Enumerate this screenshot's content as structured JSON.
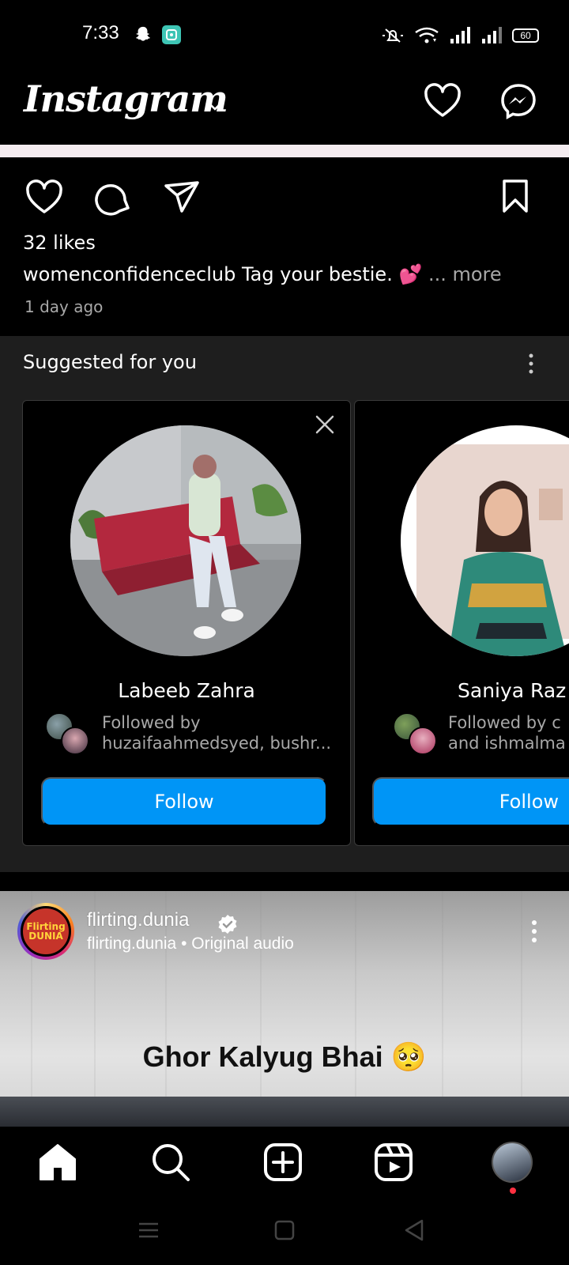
{
  "status_bar": {
    "time": "7:33",
    "battery": "60",
    "icons": [
      "snapchat-icon",
      "app-icon",
      "mute-icon",
      "wifi-icon",
      "signal-icon",
      "signal-icon-2",
      "battery-icon"
    ]
  },
  "header": {
    "logo": "Instagram",
    "icons": [
      "chevron-down-icon",
      "heart-icon",
      "messenger-icon"
    ]
  },
  "post": {
    "likes": "32 likes",
    "caption_user": "womenconfidenceclub",
    "caption_text": " Tag your bestie. 💕",
    "caption_more": "... more",
    "time_ago": "1 day ago",
    "action_icons": [
      "heart-icon",
      "comment-icon",
      "share-icon",
      "bookmark-icon"
    ]
  },
  "suggested": {
    "title": "Suggested for you",
    "cards": [
      {
        "name": "Labeeb Zahra",
        "mutual_line1": "Followed by",
        "mutual_line2": "huzaifaahmedsyed, bushr...",
        "button": "Follow"
      },
      {
        "name": "Saniya Raz",
        "mutual_line1": "Followed by c",
        "mutual_line2": "and ishmalma",
        "button": "Follow"
      }
    ]
  },
  "reel": {
    "username": "flirting.dunia",
    "subtitle": "flirting.dunia • Original audio",
    "avatar_text": "Flirting DUNIA",
    "overlay_text": "Ghor Kalyug Bhai 🥺"
  },
  "bottom_nav": {
    "items": [
      "home-icon",
      "search-icon",
      "create-icon",
      "reels-icon",
      "profile-avatar"
    ]
  },
  "system_nav": {
    "items": [
      "menu-icon",
      "home-square-icon",
      "back-icon"
    ]
  },
  "colors": {
    "background": "#000000",
    "follow_button": "#0095f6",
    "section_bg": "#1e1e1e",
    "notification_dot": "#ff3040"
  }
}
